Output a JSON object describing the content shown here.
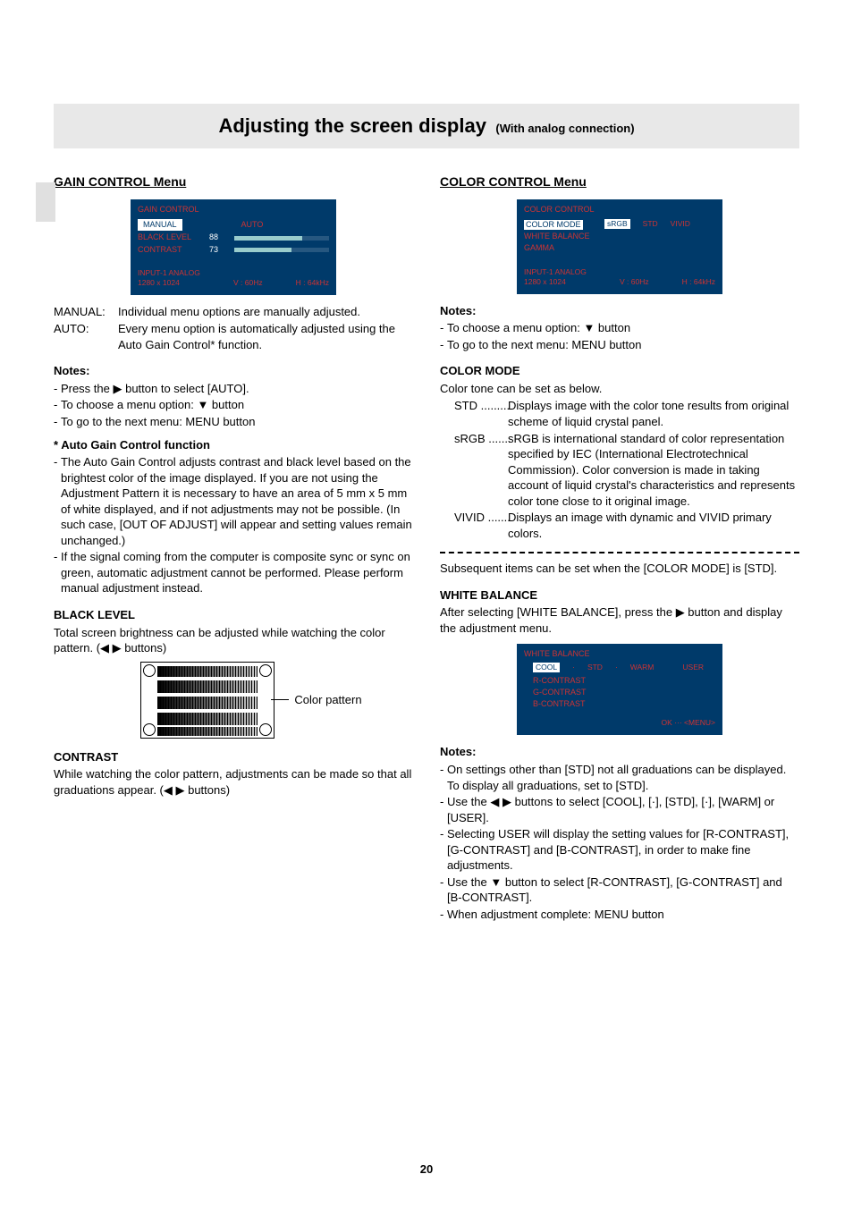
{
  "page_number": "20",
  "title": {
    "main": "Adjusting the screen display",
    "sub": "(With analog connection)"
  },
  "left": {
    "heading": "GAIN CONTROL Menu",
    "osd": {
      "title": "GAIN CONTROL",
      "tabs": {
        "manual": "MANUAL",
        "auto": "AUTO"
      },
      "rows": [
        {
          "label": "BLACK LEVEL",
          "value": "88",
          "fill": 72
        },
        {
          "label": "CONTRAST",
          "value": "73",
          "fill": 60
        }
      ],
      "status": {
        "input": "INPUT-1    ANALOG",
        "res": "1280  x 1024",
        "v": "V : 60Hz",
        "h": "H : 64kHz"
      }
    },
    "defs": [
      {
        "key": "MANUAL:",
        "val": "Individual menu options are manually adjusted."
      },
      {
        "key": "AUTO:",
        "val": "Every menu option is automatically adjusted using the Auto Gain Control* function."
      }
    ],
    "notes_head": "Notes:",
    "notes": [
      "Press the ▶ button to select [AUTO].",
      "To choose a menu option: ▼ button",
      "To go to the next menu: MENU button"
    ],
    "agc_head": "*  Auto Gain Control function",
    "agc_items": [
      "The Auto Gain Control adjusts contrast and black level based on the brightest color of the image displayed. If you are not using the Adjustment Pattern it is necessary to have an area of 5 mm x 5 mm of white displayed, and if not adjustments may not be possible. (In such case, [OUT OF ADJUST] will appear and setting values remain unchanged.)",
      "If the signal coming from the computer is composite sync or sync on green, automatic adjustment cannot be performed. Please perform manual adjustment instead."
    ],
    "black_level_head": "BLACK LEVEL",
    "black_level_body": "Total screen brightness can be adjusted while watching the color pattern. (◀ ▶ buttons)",
    "color_pattern_label": "Color pattern",
    "contrast_head": "CONTRAST",
    "contrast_body": "While watching the color pattern, adjustments can be made so that all graduations appear. (◀ ▶ buttons)"
  },
  "right": {
    "heading": "COLOR CONTROL Menu",
    "osd": {
      "title": "COLOR CONTROL",
      "items": [
        "COLOR MODE",
        "WHITE BALANCE",
        "GAMMA"
      ],
      "opts": [
        "sRGB",
        "STD",
        "VIVID"
      ],
      "status": {
        "input": "INPUT-1    ANALOG",
        "res": "1280  x 1024",
        "v": "V : 60Hz",
        "h": "H : 64kHz"
      }
    },
    "notes_head": "Notes:",
    "notes": [
      "To choose a menu option: ▼ button",
      "To go to the next menu: MENU button"
    ],
    "color_mode_head": "COLOR MODE",
    "color_mode_intro": "Color tone can be set as below.",
    "color_modes": [
      {
        "k": "STD",
        "dots": ".........",
        "v": "Displays image with the color tone results from original scheme of liquid crystal panel."
      },
      {
        "k": "sRGB",
        "dots": ".......",
        "v": "sRGB is international standard of color representation specified by IEC (International Electrotechnical Commission). Color conversion is made in taking account of liquid crystal's characteristics and represents color tone close to it original image."
      },
      {
        "k": "VIVID",
        "dots": ".......",
        "v": "Displays an image with dynamic and VIVID primary colors."
      }
    ],
    "subsequent": "Subsequent items can be set when the [COLOR MODE] is [STD].",
    "wb_head": "WHITE BALANCE",
    "wb_body": "After selecting [WHITE BALANCE], press the ▶ button and display the adjustment menu.",
    "wb_osd": {
      "title": "WHITE BALANCE",
      "opts": [
        "COOL",
        "·",
        "STD",
        "·",
        "WARM",
        "USER"
      ],
      "items": [
        "R-CONTRAST",
        "G-CONTRAST",
        "B-CONTRAST"
      ],
      "ok": "OK  ···  <MENU>"
    },
    "wb_notes_head": "Notes:",
    "wb_notes": [
      "On settings other than [STD] not all graduations can be displayed. To display all graduations, set to [STD].",
      "Use the ◀ ▶ buttons to select [COOL], [·], [STD], [·], [WARM] or [USER].",
      "Selecting USER will display the setting values for [R-CONTRAST], [G-CONTRAST] and [B-CONTRAST], in order to make fine adjustments.",
      "Use the ▼ button to select [R-CONTRAST], [G-CONTRAST] and [B-CONTRAST].",
      "When adjustment complete: MENU button"
    ]
  }
}
